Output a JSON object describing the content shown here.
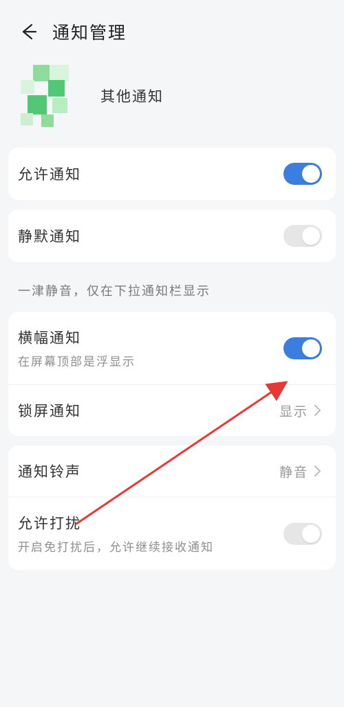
{
  "header": {
    "title": "通知管理"
  },
  "app": {
    "name": "其他通知"
  },
  "allow": {
    "label": "允许通知",
    "on": true
  },
  "silent": {
    "label": "静默通知",
    "on": false
  },
  "silentHint": "一津静音，仅在下拉通知栏显示",
  "banner": {
    "label": "横幅通知",
    "sub": "在屏幕顶部是浮显示",
    "on": true
  },
  "lockscreen": {
    "label": "锁屏通知",
    "value": "显示"
  },
  "ringtone": {
    "label": "通知铃声",
    "value": "静音"
  },
  "dnd": {
    "label": "允许打扰",
    "sub": "开启免打扰后，允许继续接收通知",
    "on": false
  }
}
